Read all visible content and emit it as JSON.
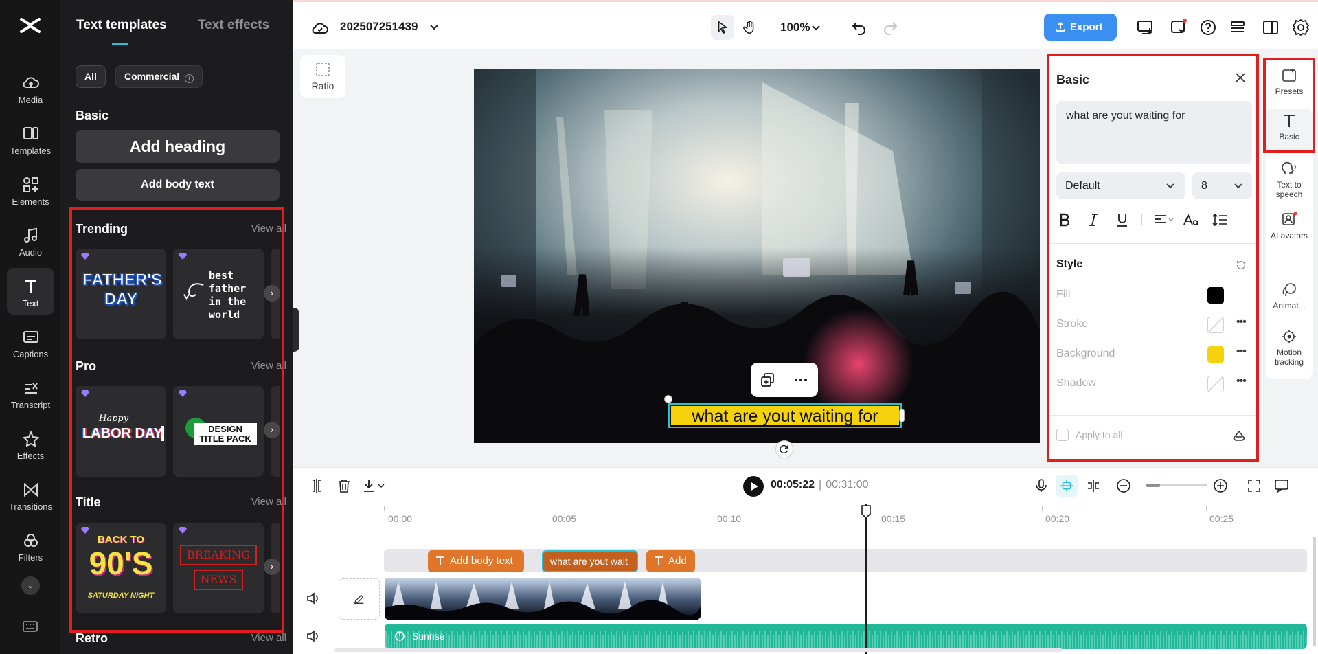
{
  "rail": {
    "items": [
      {
        "label": "Media"
      },
      {
        "label": "Templates"
      },
      {
        "label": "Elements"
      },
      {
        "label": "Audio"
      },
      {
        "label": "Text"
      },
      {
        "label": "Captions"
      },
      {
        "label": "Transcript"
      },
      {
        "label": "Effects"
      },
      {
        "label": "Transitions"
      },
      {
        "label": "Filters"
      }
    ]
  },
  "panel": {
    "tabs": [
      "Text templates",
      "Text effects"
    ],
    "chips": [
      "All",
      "Commercial"
    ],
    "basic_title": "Basic",
    "add_heading": "Add heading",
    "add_body": "Add body text",
    "view_all": "View all",
    "sections": [
      {
        "title": "Trending"
      },
      {
        "title": "Pro"
      },
      {
        "title": "Title"
      },
      {
        "title": "Retro"
      }
    ],
    "tiles": {
      "fathers_day": "FATHER'S DAY",
      "best_father": "best father in the world",
      "labor_day_small": "Happy",
      "labor_day": "LABOR DAY",
      "design_title": "DESIGN TITLE PACK",
      "back_to": "BACK TO",
      "nineties": "90'S",
      "saturday": "SATURDAY NIGHT",
      "breaking": "BREAKING",
      "news": "NEWS"
    }
  },
  "topbar": {
    "project_name": "202507251439",
    "zoom": "100%",
    "export_label": "Export"
  },
  "canvas": {
    "ratio_label": "Ratio",
    "caption": "what are yout waiting for"
  },
  "props": {
    "title": "Basic",
    "text_value": "what are yout waiting for",
    "font": "Default",
    "size": "8",
    "style_title": "Style",
    "fill_label": "Fill",
    "stroke_label": "Stroke",
    "background_label": "Background",
    "shadow_label": "Shadow",
    "apply_all": "Apply to all",
    "fill_color": "#000000",
    "background_color": "#f5d20b"
  },
  "rightrail": {
    "items": [
      {
        "label": "Presets"
      },
      {
        "label": "Basic"
      },
      {
        "label": "Text to speech"
      },
      {
        "label": "AI avatars"
      },
      {
        "label": "Animat..."
      },
      {
        "label": "Motion tracking"
      }
    ]
  },
  "timeline": {
    "current": "00:05:22",
    "separator": "|",
    "duration": "00:31:00",
    "ticks": [
      "00:00",
      "00:05",
      "00:10",
      "00:15",
      "00:20",
      "00:25"
    ],
    "clips": [
      "Add body text",
      "what are yout wait",
      "Add"
    ],
    "audio_label": "Sunrise"
  }
}
